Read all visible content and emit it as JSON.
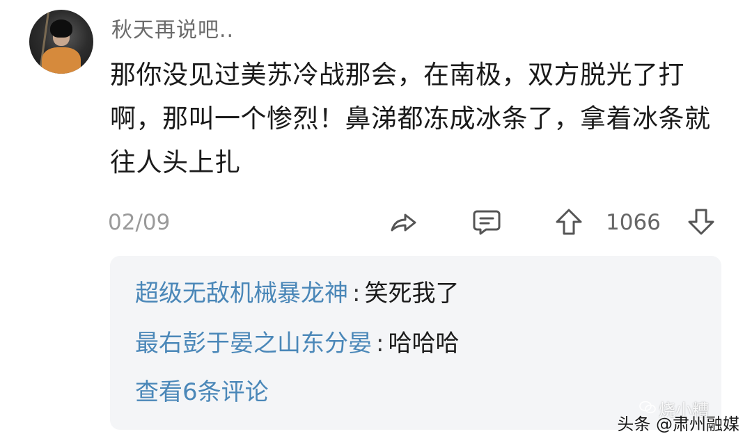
{
  "comment": {
    "username": "秋天再说吧..",
    "text": "那你没见过美苏冷战那会，在南极，双方脱光了打啊，那叫一个惨烈！鼻涕都冻成冰条了，拿着冰条就往人头上扎",
    "date": "02/09",
    "vote_count": "1066",
    "icons": {
      "share": "share-arrow-icon",
      "comment": "comment-bubble-icon",
      "upvote": "upvote-arrow-icon",
      "downvote": "downvote-arrow-icon"
    }
  },
  "replies": {
    "items": [
      {
        "name": "超级无敌机械暴龙神",
        "sep": ":",
        "text": "笑死我了"
      },
      {
        "name": "最右彭于晏之山东分晏",
        "sep": ":",
        "text": "哈哈哈"
      }
    ],
    "view_more": "查看6条评论"
  },
  "watermark": {
    "ghost": "烧小糟",
    "text": "头条 @肃州融媒"
  },
  "colors": {
    "reply_name": "#4a87b8",
    "reply_box_bg": "#f4f5f7",
    "body_text": "#1a1a1a",
    "meta_text": "#9a9a9a"
  }
}
